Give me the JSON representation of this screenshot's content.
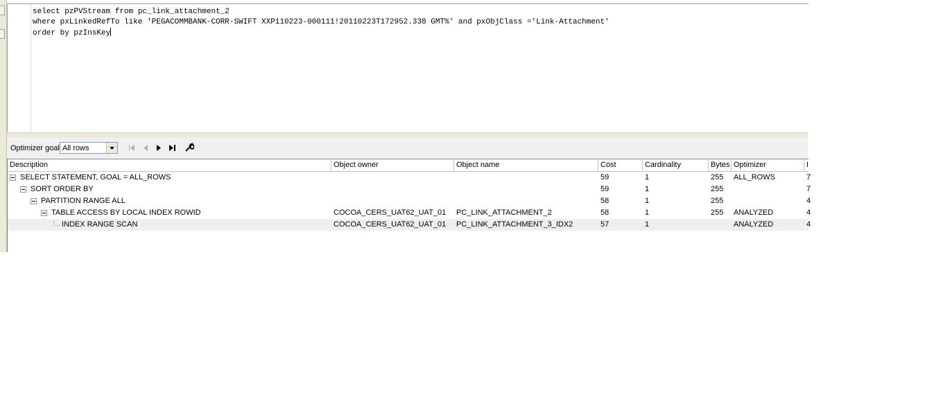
{
  "editor": {
    "lines": [
      "select pzPVStream from pc_link_attachment_2",
      "where pxLinkedRefTo like 'PEGACOMMBANK-CORR-SWIFT XXP110223-000111!20110223T172952.338 GMT%' and pxObjClass ='Link-Attachment'",
      "order by pzInsKey"
    ]
  },
  "toolbar": {
    "optimizer_label": "Optimizer goal",
    "optimizer_value": "All rows",
    "icons": [
      "first-icon",
      "previous-icon",
      "next-icon",
      "last-icon",
      "wrench-icon"
    ]
  },
  "grid": {
    "columns": [
      "Description",
      "Object owner",
      "Object name",
      "Cost",
      "Cardinality",
      "Bytes",
      "Optimizer",
      "I"
    ],
    "rows": [
      {
        "description": "SELECT STATEMENT, GOAL = ALL_ROWS",
        "owner": "",
        "name": "",
        "cost": "59",
        "cardinality": "1",
        "bytes": "255",
        "optimizer": "ALL_ROWS",
        "extra": "7"
      },
      {
        "description": "SORT ORDER BY",
        "owner": "",
        "name": "",
        "cost": "59",
        "cardinality": "1",
        "bytes": "255",
        "optimizer": "",
        "extra": "7"
      },
      {
        "description": "PARTITION RANGE ALL",
        "owner": "",
        "name": "",
        "cost": "58",
        "cardinality": "1",
        "bytes": "255",
        "optimizer": "",
        "extra": "4"
      },
      {
        "description": "TABLE ACCESS BY LOCAL INDEX ROWID",
        "owner": "COCOA_CERS_UAT62_UAT_01",
        "name": "PC_LINK_ATTACHMENT_2",
        "cost": "58",
        "cardinality": "1",
        "bytes": "255",
        "optimizer": "ANALYZED",
        "extra": "4"
      },
      {
        "description": "INDEX RANGE SCAN",
        "owner": "COCOA_CERS_UAT62_UAT_01",
        "name": "PC_LINK_ATTACHMENT_3_IDX2",
        "cost": "57",
        "cardinality": "1",
        "bytes": "",
        "optimizer": "ANALYZED",
        "extra": "4"
      }
    ]
  }
}
